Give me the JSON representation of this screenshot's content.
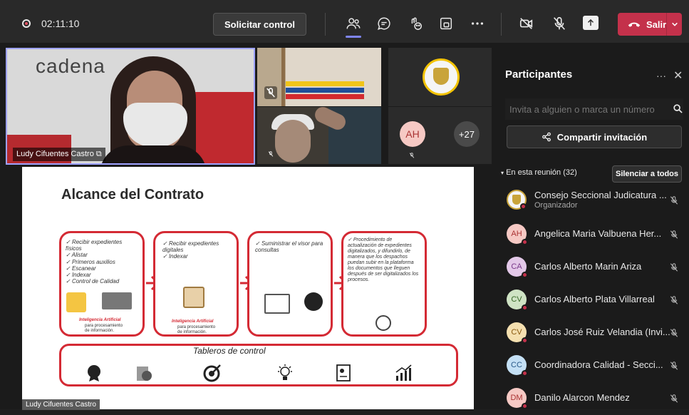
{
  "toolbar": {
    "timer": "02:11:10",
    "request_control": "Solicitar control",
    "leave": "Salir"
  },
  "stage": {
    "brand": "cadena",
    "speaker_label": "Ludy Cifuentes Castro",
    "more_count": "+27",
    "avatar_initials": "AH",
    "slide_presenter_label": "Ludy Cifuentes Castro"
  },
  "slide": {
    "title": "Alcance del Contrato",
    "box1": [
      "Recibir expedientes físicos",
      "Alistar",
      "Primeros auxilios",
      "Escanear",
      "Indexar",
      "Control de Calidad"
    ],
    "box2": [
      "Recibir expedientes digitales",
      "Indexar"
    ],
    "box3": [
      "Suministrar el visor para consultas"
    ],
    "box4": [
      "Procedimiento de actualización de expedientes digitalizados, y difundirlo, de manera que los despachos puedan subir en la plataforma los documentos que lleguen después de ser digitalizados los procesos."
    ],
    "ai_label": "Inteligencia Artificial",
    "ai_sub1": "para procesamiento",
    "ai_sub2": "de información.",
    "dashboard_title": "Tableros de control"
  },
  "panel": {
    "title": "Participantes",
    "invite_placeholder": "Invita a alguien o marca un número",
    "share_invite": "Compartir invitación",
    "section": "En esta reunión (32)",
    "mute_all": "Silenciar a todos",
    "participants": [
      {
        "initials": "",
        "name": "Consejo Seccional Judicatura ...",
        "role": "Organizador",
        "color": "#f5f5f5"
      },
      {
        "initials": "AH",
        "name": "Angelica Maria Valbuena Her...",
        "role": "",
        "color": "#f6c9c4"
      },
      {
        "initials": "CA",
        "name": "Carlos Alberto Marin Ariza",
        "role": "",
        "color": "#e3c8e8"
      },
      {
        "initials": "CV",
        "name": "Carlos Alberto Plata Villarreal",
        "role": "",
        "color": "#cfe3c4"
      },
      {
        "initials": "CV",
        "name": "Carlos José Ruiz Velandia (Invi...",
        "role": "",
        "color": "#f5e0b0"
      },
      {
        "initials": "CC",
        "name": "Coordinadora Calidad - Secci...",
        "role": "",
        "color": "#c4e0f5"
      },
      {
        "initials": "DM",
        "name": "Danilo Alarcon Mendez",
        "role": "",
        "color": "#f6c9c4"
      }
    ]
  },
  "colors": {
    "accent": "#7f85f5",
    "leave": "#c4314b",
    "slide_red": "#d42a34"
  }
}
